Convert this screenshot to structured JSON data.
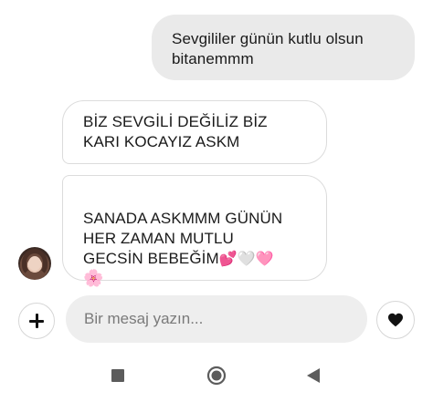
{
  "messages": {
    "outgoing_1": "Sevgililer günün kutlu olsun\nbitanemmm",
    "incoming_1": "BİZ SEVGİLİ DEĞİLİZ BİZ\nKARI KOCAYIZ ASKM",
    "incoming_2_text": "SANADA ASKMMM GÜNÜN\nHER ZAMAN MUTLU\nGECSİN BEBEĞİM",
    "incoming_2_emojis": [
      "💕",
      "🤍",
      "🩷",
      "🌸"
    ]
  },
  "composer": {
    "placeholder": "Bir mesaj yazın..."
  },
  "icons": {
    "add": "plus-icon",
    "like": "heart-icon",
    "nav_recents": "square-icon",
    "nav_home": "circle-icon",
    "nav_back": "triangle-back-icon"
  },
  "colors": {
    "outgoing_bubble": "#eaeaea",
    "incoming_border": "#dcdcdc",
    "input_bg": "#eeeeee",
    "nav_icon": "#5c5c5c"
  }
}
